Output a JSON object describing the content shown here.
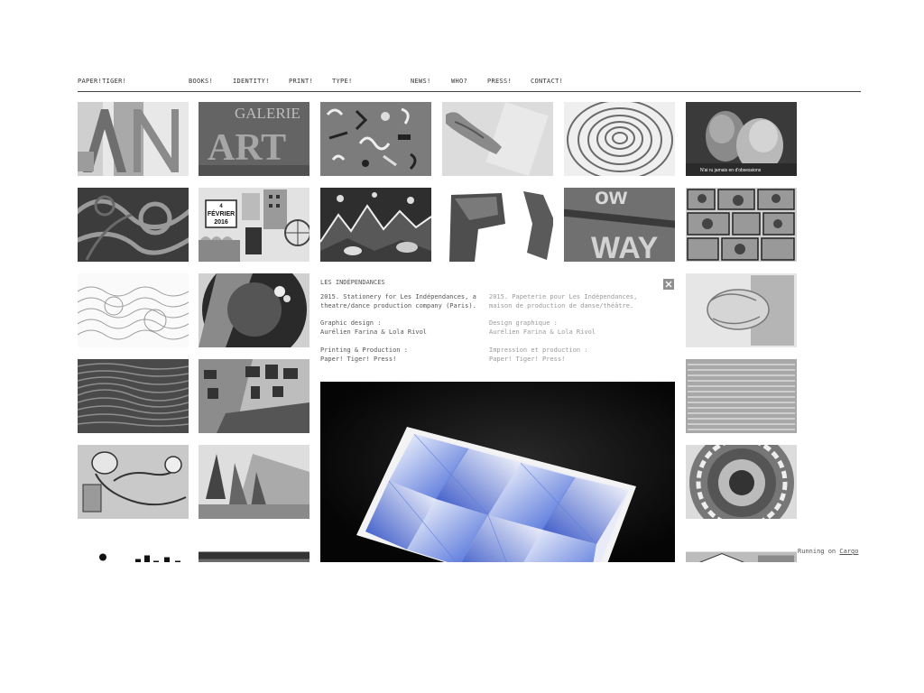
{
  "nav": {
    "brand": "PAPER!TIGER!",
    "items": [
      "BOOKS!",
      "IDENTITY!",
      "PRINT!",
      "TYPE!",
      "NEWS!",
      "WHO?",
      "PRESS!",
      "CONTACT!"
    ]
  },
  "thumbnails": {
    "kiss_caption": "N'ai ru jamais en d'obsessions",
    "calendar_day": "4",
    "calendar_month": "FÉVRIER",
    "calendar_year": "2016",
    "galerie_word": "GALERIE",
    "art_word": "ART",
    "way_word": "WAY"
  },
  "overlay": {
    "title": "LES INDÉPENDANCES",
    "en": {
      "intro": "2015. Stationery for Les Indépendances, a\ntheatre/dance production company (Paris).",
      "design": "Graphic design :\nAurélien Farina & Lola Rivol",
      "production": "Printing & Production :\nPaper! Tiger! Press!"
    },
    "fr": {
      "intro": "2015. Papeterie pour Les Indépendances,\nmaison de production de danse/théâtre.",
      "design": "Design graphique :\nAurélien Farina & Lola Rivol",
      "production": "Impression et production :\nPaper! Tiger! Press!"
    },
    "close_icon": "close-icon"
  },
  "footer": {
    "prefix": "Running on",
    "link": "Cargo"
  },
  "colors": {
    "accent_blue": "#3f63d6",
    "text": "#444444",
    "rule": "#444444"
  }
}
